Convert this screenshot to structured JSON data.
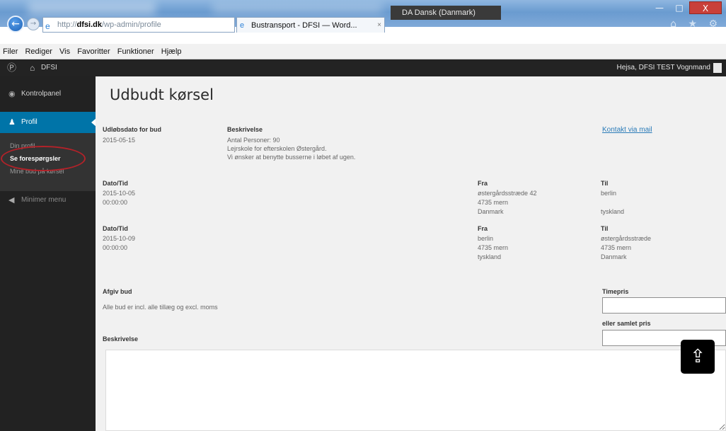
{
  "browser": {
    "language_indicator": "DA Dansk (Danmark)",
    "address_prefix": "http://",
    "address_domain": "dfsi.dk",
    "address_path": "/wp-admin/profile",
    "address_tools": "⌕ ▾ ↻",
    "tab_title": "Bustransport - DFSI — Word...",
    "tab_close": "×",
    "window_buttons": [
      "—",
      "□",
      "X"
    ],
    "right_icons": "⌂ ★ ⚙"
  },
  "menubar": {
    "items": [
      "Filer",
      "Rediger",
      "Vis",
      "Favoritter",
      "Funktioner",
      "Hjælp"
    ]
  },
  "adminbar": {
    "site_name": "DFSI",
    "howdy": "Hejsa, DFSI TEST Vognmand"
  },
  "sidebar": {
    "items": [
      {
        "label": "Kontrolpanel",
        "icon": "dashboard-icon"
      },
      {
        "label": "Profil",
        "icon": "user-icon"
      }
    ],
    "subitems": [
      "Din profil",
      "Se forespørgsler",
      "Mine bud på kørsel"
    ],
    "collapse_label": "Minimer menu"
  },
  "main": {
    "title": "Udbudt kørsel",
    "deadline_label": "Udløbsdato for bud",
    "deadline_value": "2015-05-15",
    "description_label": "Beskrivelse",
    "description_lines": [
      "Antal Personer: 90",
      "Lejrskole for efterskolen Østergård.",
      "Vi ønsker at benytte busserne i løbet af ugen."
    ],
    "contact_link": "Kontakt via mail",
    "trips": [
      {
        "date_label": "Dato/Tid",
        "date": "2015-10-05",
        "time": "00:00:00",
        "from_label": "Fra",
        "from_lines": [
          "østergårdsstræde 42",
          "4735 mern",
          "Danmark"
        ],
        "to_label": "Til",
        "to_lines": [
          "berlin",
          "",
          "tyskland"
        ]
      },
      {
        "date_label": "Dato/Tid",
        "date": "2015-10-09",
        "time": "00:00:00",
        "from_label": "Fra",
        "from_lines": [
          "berlin",
          "4735 mern",
          "tyskland"
        ],
        "to_label": "Til",
        "to_lines": [
          "østergårdsstræde",
          "4735 mern",
          "Danmark"
        ]
      }
    ],
    "bid_label": "Afgiv bud",
    "bid_note": "Alle bud er incl. alle tillæg og excl. moms",
    "hourly_label": "Timepris",
    "total_label": "eller samlet pris",
    "bid_description_label": "Beskrivelse",
    "hourly_value": "",
    "total_value": "",
    "bid_description_value": ""
  },
  "scroll_top_icon": "⇪"
}
